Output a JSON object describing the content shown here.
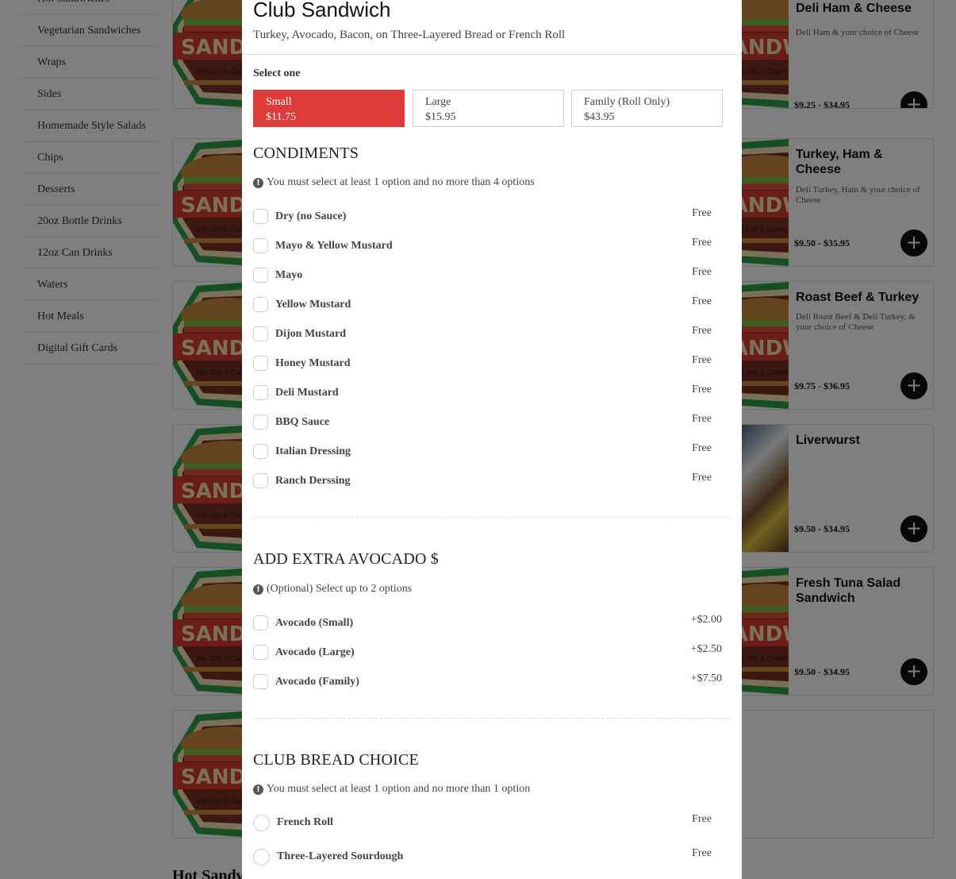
{
  "sidebar": {
    "items": [
      "Hot Sandwiches",
      "Vegetarian Sandwiches",
      "Wraps",
      "Sides",
      "Homemade Style Salads",
      "Chips",
      "Desserts",
      "20oz Bottle Drinks",
      "12oz Can Drinks",
      "Waters",
      "Hot Meals",
      "Digital Gift Cards"
    ]
  },
  "logo": {
    "text": "SANDWICH",
    "subtext": "Mill Deli & Catering",
    "colors": {
      "green": "#2e9e4a",
      "red": "#d63a2f",
      "cream": "#f7e3b5"
    }
  },
  "menu_cards": [
    {
      "title": "Deli Ham & Cheese",
      "description": "Deli Ham & your choice of Cheese",
      "price": "$9.25 - $34.95"
    },
    {
      "title": "Turkey, Ham & Cheese",
      "description": "Deli Turkey, Ham & your choice of Cheese",
      "price": "$9.50 - $35.95"
    },
    {
      "title": "Roast Beef & Turkey",
      "description": "Deli Roast Beef & Deli Turkey, & your choice of Cheese",
      "price": "$9.75 - $36.95"
    },
    {
      "title": "Liverwurst",
      "description": "",
      "price": "$9.50 - $34.95"
    },
    {
      "title": "Fresh Tuna Salad Sandwich",
      "description": "",
      "price": "$9.50 - $34.95"
    }
  ],
  "add_button_label": "+",
  "section_heading_bg": "Hot Sandw",
  "modal": {
    "title": "Club Sandwich",
    "subtitle": "Turkey, Avocado, Bacon, on Three-Layered Bread or French Roll",
    "select_label": "Select one",
    "accent_color": "#e03b3b",
    "sizes": [
      {
        "name": "Small",
        "price": "$11.75",
        "selected": true
      },
      {
        "name": "Large",
        "price": "$15.95",
        "selected": false
      },
      {
        "name": "Family (Roll Only)",
        "price": "$43.95",
        "selected": false
      }
    ],
    "info_icon_glyph": "!",
    "condiments": {
      "title": "CONDIMENTS",
      "note": "You must select at least 1 option and no more than 4 options",
      "options": [
        {
          "label": "Dry (no Sauce)",
          "price": "Free"
        },
        {
          "label": "Mayo & Yellow Mustard",
          "price": "Free"
        },
        {
          "label": "Mayo",
          "price": "Free"
        },
        {
          "label": "Yellow Mustard",
          "price": "Free"
        },
        {
          "label": "Dijon Mustard",
          "price": "Free"
        },
        {
          "label": "Honey Mustard",
          "price": "Free"
        },
        {
          "label": "Deli Mustard",
          "price": "Free"
        },
        {
          "label": "BBQ Sauce",
          "price": "Free"
        },
        {
          "label": "Italian Dressing",
          "price": "Free"
        },
        {
          "label": "Ranch Derssing",
          "price": "Free"
        }
      ]
    },
    "avocado": {
      "title": "ADD EXTRA AVOCADO $",
      "note": "(Optional) Select up to 2 options",
      "options": [
        {
          "label": "Avocado (Small)",
          "price": "+$2.00"
        },
        {
          "label": "Avocado (Large)",
          "price": "+$2.50"
        },
        {
          "label": "Avocado (Family)",
          "price": "+$7.50"
        }
      ]
    },
    "bread": {
      "title": "CLUB BREAD CHOICE",
      "note": "You must select at least 1 option and no more than 1 option",
      "options": [
        {
          "label": "French Roll",
          "price": "Free"
        },
        {
          "label": "Three-Layered Sourdough",
          "price": "Free"
        }
      ]
    }
  }
}
